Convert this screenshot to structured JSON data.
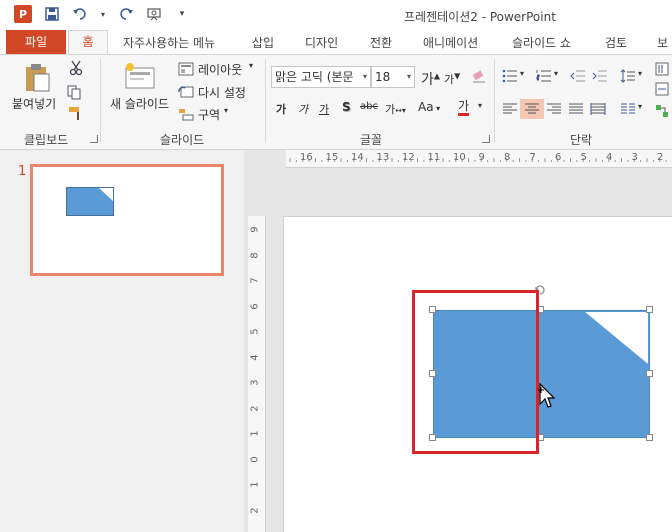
{
  "title": "프레젠테이션2 - PowerPoint",
  "app_logo_text": "P",
  "tabs": [
    {
      "label": "파일",
      "active": false
    },
    {
      "label": "홈",
      "active": true
    },
    {
      "label": "자주사용하는 메뉴"
    },
    {
      "label": "삽입"
    },
    {
      "label": "디자인"
    },
    {
      "label": "전환"
    },
    {
      "label": "애니메이션"
    },
    {
      "label": "슬라이드 쇼"
    },
    {
      "label": "검토"
    },
    {
      "label": "보"
    }
  ],
  "ribbon": {
    "clipboard": {
      "group_label": "클립보드",
      "paste_label": "붙여넣기"
    },
    "slides": {
      "group_label": "슬라이드",
      "new_slide_label": "새 슬라이드",
      "layout_label": "레이아웃",
      "reset_label": "다시 설정",
      "section_label": "구역"
    },
    "font": {
      "group_label": "글꼴",
      "font_name": "맑은 고딕 (본문",
      "font_size": "18",
      "spacing_label": "가",
      "case_label": "Aa",
      "color_label": "가",
      "grow_label": "가",
      "shrink_label": "가",
      "bold_label": "가",
      "italic_label": "가",
      "underline_label": "가",
      "shadow_label": "S",
      "strike_label": "abc"
    },
    "paragraph": {
      "group_label": "단락"
    }
  },
  "slide_panel": {
    "slide_number": "1"
  },
  "ruler": {
    "horizontal_ticks": [
      "16",
      "15",
      "14",
      "13",
      "12",
      "11",
      "10",
      "9",
      "8",
      "7",
      "6",
      "5",
      "4",
      "3",
      "2"
    ],
    "vertical_ticks": [
      "9",
      "8",
      "7",
      "6",
      "5",
      "4",
      "3",
      "2",
      "1",
      "0",
      "1",
      "2"
    ]
  },
  "colors": {
    "accent": "#d24726",
    "shape_fill": "#5b9bd5",
    "highlight_box": "#d6262b"
  },
  "icons": [
    "save-icon",
    "undo-icon",
    "redo-icon",
    "presenter-icon",
    "scissors-icon",
    "copy-icon",
    "format-painter-icon",
    "bullets-icon",
    "numbering-icon",
    "align-left-icon",
    "align-center-icon",
    "align-right-icon",
    "justify-icon"
  ]
}
